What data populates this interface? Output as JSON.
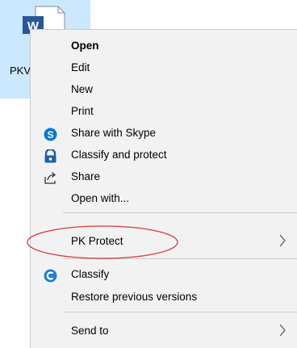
{
  "file": {
    "name": "PKV",
    "icon": "word-document-icon",
    "tile_color": "#cce8ff"
  },
  "context_menu": {
    "items": [
      {
        "label": "Open",
        "bold": true,
        "icon": null,
        "submenu": false
      },
      {
        "label": "Edit",
        "icon": null,
        "submenu": false
      },
      {
        "label": "New",
        "icon": null,
        "submenu": false
      },
      {
        "label": "Print",
        "icon": null,
        "submenu": false
      },
      {
        "label": "Share with Skype",
        "icon": "skype-icon",
        "submenu": false
      },
      {
        "label": "Classify and protect",
        "icon": "azure-information-protection-icon",
        "submenu": false
      },
      {
        "label": "Share",
        "icon": "share-icon",
        "submenu": false
      },
      {
        "label": "Open with...",
        "icon": null,
        "submenu": false
      },
      {
        "label": "PK Protect",
        "icon": null,
        "submenu": true,
        "highlighted": true
      },
      {
        "label": "Classify",
        "icon": "classify-icon",
        "submenu": false
      },
      {
        "label": "Restore previous versions",
        "icon": null,
        "submenu": false
      },
      {
        "label": "Send to",
        "icon": null,
        "submenu": true
      }
    ]
  },
  "colors": {
    "menu_background": "#f2f2f2",
    "skype": "#0078d7",
    "classify_protect": "#1e5fa8",
    "classify": "#1e7ed8",
    "highlight_ellipse": "#d9363e",
    "word_blue": "#2b579a"
  }
}
